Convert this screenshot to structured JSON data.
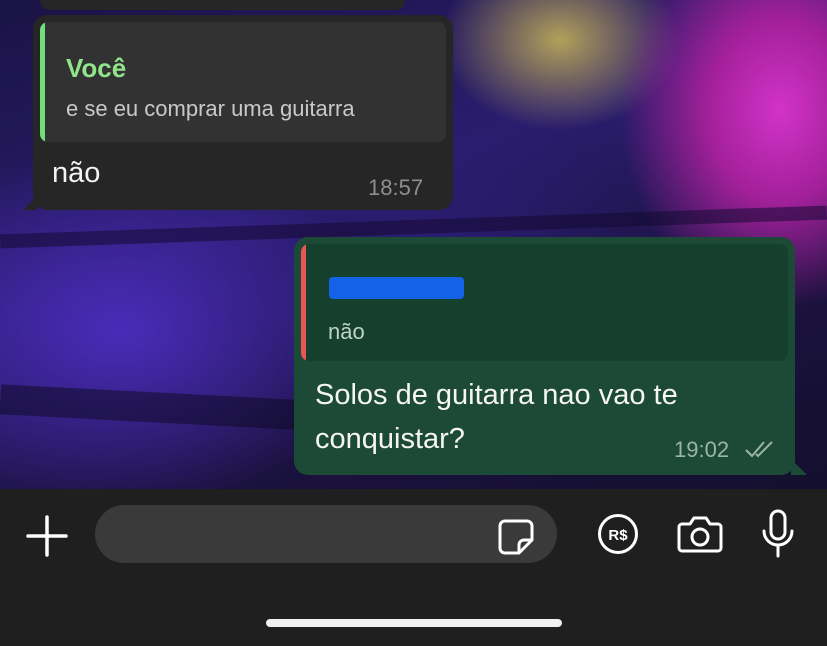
{
  "messages": {
    "incoming": {
      "quote_author": "Você",
      "quote_text": "e se eu comprar uma guitarra",
      "text": "não",
      "time": "18:57"
    },
    "outgoing": {
      "quote_text": "não",
      "text": "Solos de guitarra nao vao te conquistar?",
      "time": "19:02",
      "status_icon": "double-check-icon"
    }
  },
  "composer": {
    "placeholder": "",
    "buttons": [
      "plus-icon",
      "sticker-icon",
      "pix-payment-icon",
      "camera-icon",
      "microphone-icon"
    ],
    "pay_label": "R$"
  },
  "colors": {
    "incoming_bubble": "#262626",
    "outgoing_bubble": "#1d4a36",
    "quote_author": "#90e58c",
    "quote_bar_in": "#6fdf7a",
    "quote_bar_out": "#e85656",
    "redaction": "#1462e6"
  }
}
